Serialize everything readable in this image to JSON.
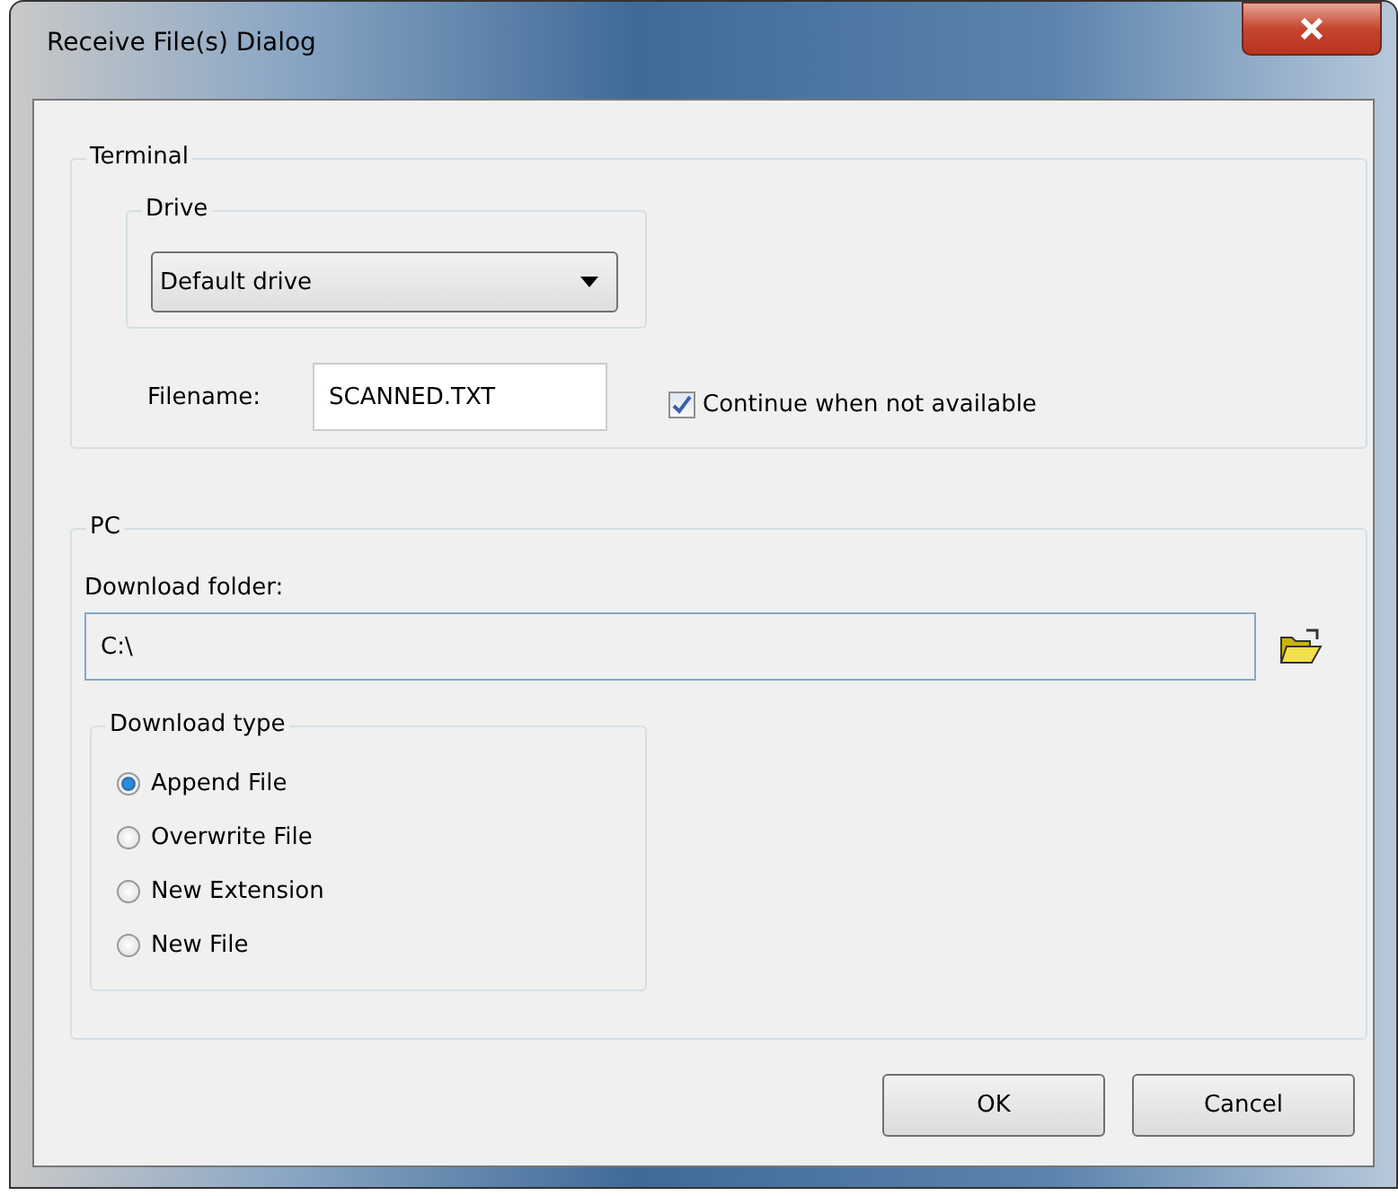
{
  "window": {
    "title": "Receive File(s) Dialog"
  },
  "terminal": {
    "title": "Terminal",
    "drive": {
      "title": "Drive",
      "value": "Default drive"
    },
    "filename_label": "Filename:",
    "filename": "SCANNED.TXT",
    "continue": {
      "label": "Continue when not available",
      "checked": true
    }
  },
  "pc": {
    "title": "PC",
    "folder_label": "Download folder:",
    "folder": "C:\\",
    "download_type": {
      "title": "Download type",
      "options": [
        {
          "label": "Append File",
          "selected": true
        },
        {
          "label": "Overwrite File",
          "selected": false
        },
        {
          "label": "New Extension",
          "selected": false
        },
        {
          "label": "New File",
          "selected": false
        }
      ]
    }
  },
  "buttons": [
    "OK",
    "Cancel"
  ]
}
